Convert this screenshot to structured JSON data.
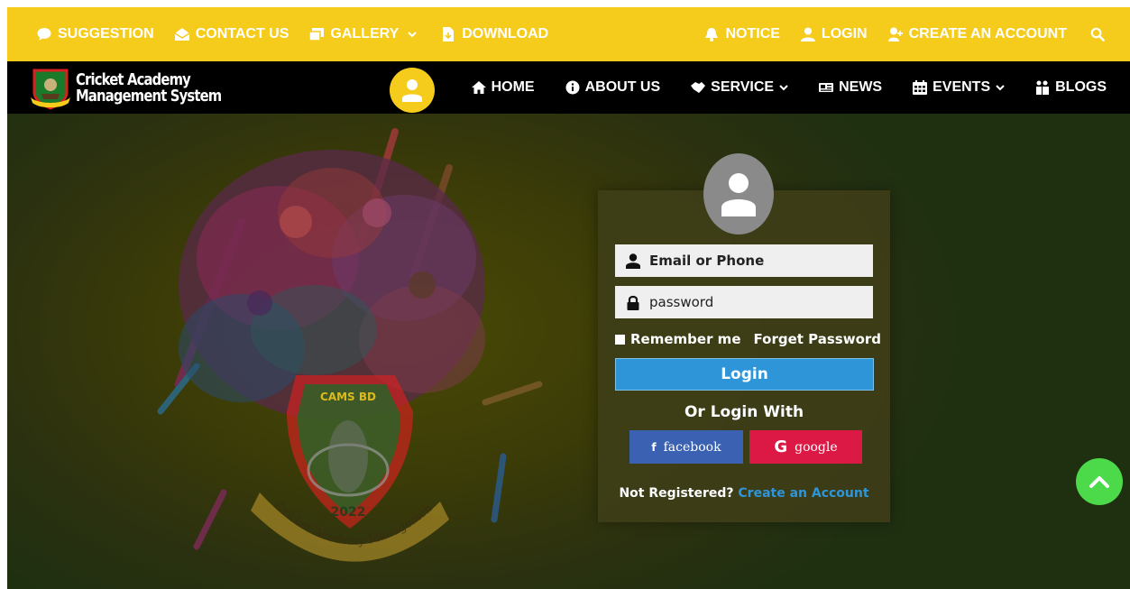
{
  "topbar": {
    "left": [
      {
        "label": "SUGGESTION",
        "icon": "chat-bubble-icon"
      },
      {
        "label": "CONTACT US",
        "icon": "envelope-open-icon"
      },
      {
        "label": "GALLERY",
        "icon": "images-icon",
        "dropdown": true
      },
      {
        "label": "DOWNLOAD",
        "icon": "file-download-icon"
      }
    ],
    "right": [
      {
        "label": "NOTICE",
        "icon": "bell-icon"
      },
      {
        "label": "LOGIN",
        "icon": "user-icon"
      },
      {
        "label": "CREATE AN ACCOUNT",
        "icon": "user-plus-icon"
      }
    ],
    "search_icon": "search-icon",
    "color": "#f6cc1c"
  },
  "navbar": {
    "logo_line1": "Cricket Academy",
    "logo_line2": "Management System",
    "links": [
      {
        "label": "HOME",
        "icon": "home-icon"
      },
      {
        "label": "ABOUT US",
        "icon": "info-circle-icon"
      },
      {
        "label": "SERVICE",
        "icon": "handshake-icon",
        "dropdown": true
      },
      {
        "label": "NEWS",
        "icon": "newspaper-icon"
      },
      {
        "label": "EVENTS",
        "icon": "calendar-icon",
        "dropdown": true
      },
      {
        "label": "BLOGS",
        "icon": "blog-icon"
      }
    ]
  },
  "hero": {
    "emblem_text": "CAMS BD",
    "emblem_year": "2022",
    "emblem_ribbon": "Cricket Academy Management System"
  },
  "login": {
    "email_placeholder": "Email or Phone",
    "password_placeholder": "password",
    "remember_label": "Remember me",
    "forget_label": "Forget Password",
    "login_label": "Login",
    "or_login_with": "Or Login With",
    "facebook_label": "facebook",
    "google_label": "google",
    "not_registered": "Not Registered?",
    "create_account": "Create an Account",
    "colors": {
      "login_button": "#2e95d8",
      "facebook": "#3b62b2",
      "google": "#dc1945",
      "scroll_top": "#4cd94a"
    }
  }
}
